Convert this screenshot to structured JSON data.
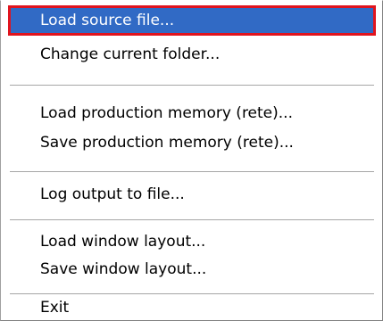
{
  "menu": {
    "items": [
      {
        "label": "Load source file...",
        "selected": true
      },
      {
        "label": "Change current folder..."
      },
      {
        "label": "Load production memory (rete)..."
      },
      {
        "label": "Save production memory (rete)..."
      },
      {
        "label": "Log output to  file..."
      },
      {
        "label": "Load window layout..."
      },
      {
        "label": "Save window layout..."
      },
      {
        "label": "Exit"
      }
    ],
    "colors": {
      "highlight_bg": "#316ac5",
      "highlight_text": "#ffffff",
      "focus_outline": "#e0141e",
      "separator": "#a6a6a6"
    }
  }
}
